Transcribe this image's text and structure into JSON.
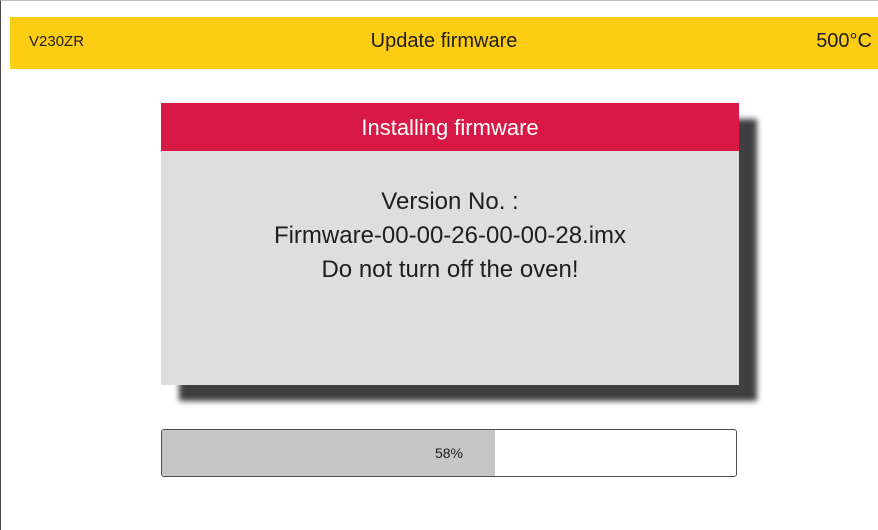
{
  "header": {
    "model": "V230ZR",
    "title": "Update firmware",
    "temperature": "500°C"
  },
  "dialog": {
    "title": "Installing firmware",
    "version_label": "Version No. :",
    "version_value": "Firmware-00-00-26-00-00-28.imx",
    "warning": "Do not turn off the oven!"
  },
  "progress": {
    "percent": 58,
    "label": "58%"
  },
  "colors": {
    "header_bg": "#fdcd14",
    "dialog_header_bg": "#d81946",
    "dialog_body_bg": "#dedede",
    "progress_fill": "#c6c6c6"
  }
}
